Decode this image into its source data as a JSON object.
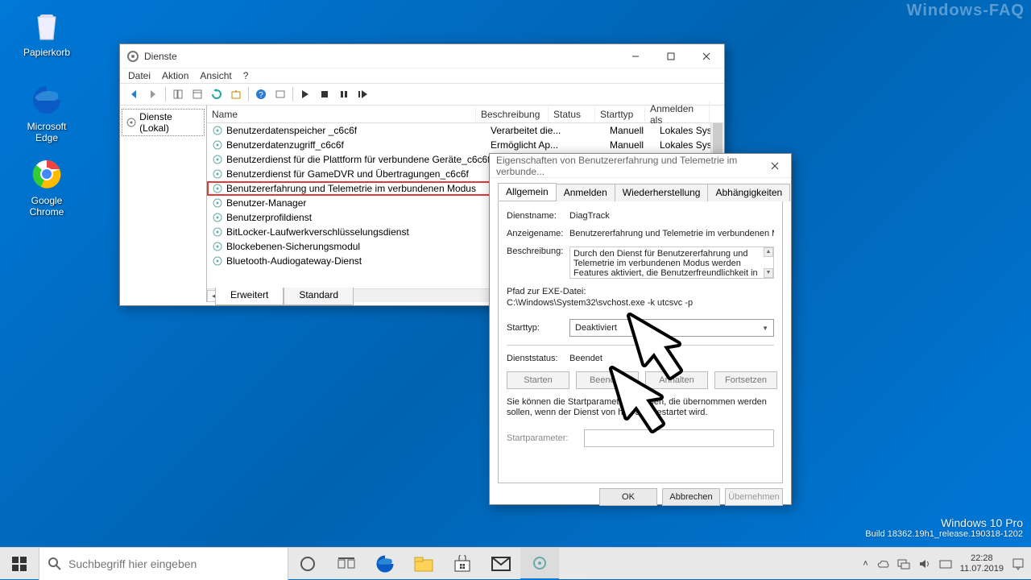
{
  "desktop": {
    "icons": [
      {
        "name": "recycle-bin",
        "label": "Papierkorb"
      },
      {
        "name": "edge",
        "label": "Microsoft Edge"
      },
      {
        "name": "chrome",
        "label": "Google Chrome"
      }
    ],
    "faq_watermark": "Windows-FAQ"
  },
  "watermark": {
    "line1": "Windows 10 Pro",
    "line2": "Build 18362.19h1_release.190318-1202"
  },
  "services_window": {
    "title": "Dienste",
    "menu": [
      "Datei",
      "Aktion",
      "Ansicht",
      "?"
    ],
    "tree_root": "Dienste (Lokal)",
    "columns": [
      "Name",
      "Beschreibung",
      "Status",
      "Starttyp",
      "Anmelden als"
    ],
    "rows": [
      {
        "name": "Benutzerdatenspeicher _c6c6f",
        "desc": "Verarbeitet die...",
        "status": "",
        "start": "Manuell",
        "logon": "Lokales Syste"
      },
      {
        "name": "Benutzerdatenzugriff_c6c6f",
        "desc": "Ermöglicht Ap...",
        "status": "",
        "start": "Manuell",
        "logon": "Lokales Syste"
      },
      {
        "name": "Benutzerdienst für die Plattform für verbundene Geräte_c6c6f",
        "desc": "",
        "status": "",
        "start": "",
        "logon": ""
      },
      {
        "name": "Benutzerdienst für GameDVR und Übertragungen_c6c6f",
        "desc": "",
        "status": "",
        "start": "",
        "logon": ""
      },
      {
        "name": "Benutzererfahrung und Telemetrie im verbundenen Modus",
        "desc": "",
        "status": "",
        "start": "",
        "logon": "",
        "selected": true
      },
      {
        "name": "Benutzer-Manager",
        "desc": "",
        "status": "",
        "start": "",
        "logon": ""
      },
      {
        "name": "Benutzerprofildienst",
        "desc": "",
        "status": "",
        "start": "",
        "logon": ""
      },
      {
        "name": "BitLocker-Laufwerkverschlüsselungsdienst",
        "desc": "",
        "status": "",
        "start": "",
        "logon": ""
      },
      {
        "name": "Blockebenen-Sicherungsmodul",
        "desc": "",
        "status": "",
        "start": "",
        "logon": ""
      },
      {
        "name": "Bluetooth-Audiogateway-Dienst",
        "desc": "",
        "status": "",
        "start": "",
        "logon": ""
      }
    ],
    "tabs": [
      "Erweitert",
      "Standard"
    ]
  },
  "properties_dialog": {
    "title": "Eigenschaften von Benutzererfahrung und Telemetrie im verbunde...",
    "tabs": [
      "Allgemein",
      "Anmelden",
      "Wiederherstellung",
      "Abhängigkeiten"
    ],
    "labels": {
      "service_name": "Dienstname:",
      "display_name": "Anzeigename:",
      "description": "Beschreibung:",
      "exe_path": "Pfad zur EXE-Datei:",
      "startup_type": "Starttyp:",
      "service_status": "Dienststatus:",
      "start_params": "Startparameter:"
    },
    "values": {
      "service_name": "DiagTrack",
      "display_name": "Benutzererfahrung und Telemetrie im verbundenen Modu",
      "description": "Durch den Dienst für Benutzererfahrung und Telemetrie im verbundenen Modus werden Features aktiviert, die Benutzerfreundlichkeit in Anwendungen",
      "exe_path": "C:\\Windows\\System32\\svchost.exe -k utcsvc -p",
      "startup_type": "Deaktiviert",
      "service_status": "Beendet"
    },
    "buttons": {
      "start": "Starten",
      "stop": "Beenden",
      "pause": "Anhalten",
      "resume": "Fortsetzen"
    },
    "hint": "Sie können die Startparameter angeben, die übernommen werden sollen, wenn der Dienst von hier aus gestartet wird.",
    "dialog_buttons": {
      "ok": "OK",
      "cancel": "Abbrechen",
      "apply": "Übernehmen"
    }
  },
  "taskbar": {
    "search_placeholder": "Suchbegriff hier eingeben",
    "time": "22:28",
    "date": "11.07.2019"
  }
}
